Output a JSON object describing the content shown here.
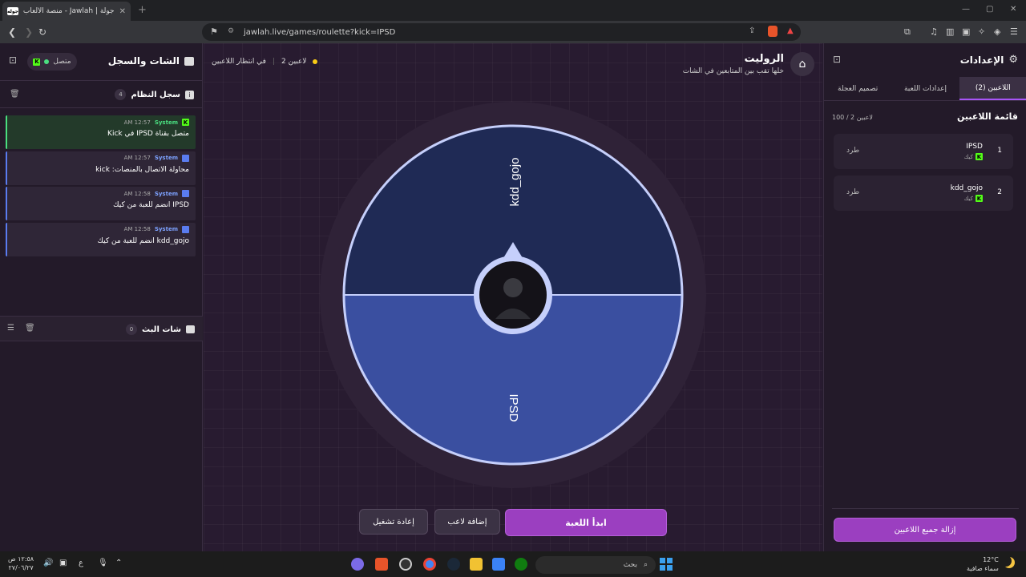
{
  "browser": {
    "tab_title": "جولة | Jawlah - منصة الألعاب التفا",
    "tab_badge": "جوله",
    "url": "jawlah.live/games/roulette?kick=IPSD"
  },
  "chat_panel": {
    "title": "الشات والسجل",
    "status": "متصل",
    "system_log": {
      "title": "سجل النظام",
      "count": "4",
      "entries": [
        {
          "who": "System",
          "time": "12:57 AM",
          "message": "متصل بقناة IPSD في Kick",
          "color": "#4ade80"
        },
        {
          "who": "System",
          "time": "12:57 AM",
          "message": "محاولة الاتصال بالمنصات: kick",
          "color": "#5a7cf0"
        },
        {
          "who": "System",
          "time": "12:58 AM",
          "message": "IPSD انضم للعبة من كيك",
          "color": "#5a7cf0"
        },
        {
          "who": "System",
          "time": "12:58 AM",
          "message": "kdd_gojo انضم للعبة من كيك",
          "color": "#5a7cf0"
        }
      ]
    },
    "stream_chat": {
      "title": "شات البث",
      "count": "0"
    }
  },
  "game_header": {
    "title": "الروليت",
    "subtitle": "خلها تقب بين المتابعين في الشات",
    "players_count": "2 لاعبين",
    "status": "في انتظار اللاعبين"
  },
  "wheel": {
    "segments": [
      {
        "label": "kdd_gojo",
        "color": "#1f2a55"
      },
      {
        "label": "IPSD",
        "color": "#3a4fa0"
      }
    ]
  },
  "actions": {
    "start": "ابدأ اللعبة",
    "add_player": "إضافة لاعب",
    "restart": "إعادة تشغيل"
  },
  "settings_panel": {
    "title": "الإعدادات",
    "tabs": [
      "اللاعبين (2)",
      "إعدادات اللعبة",
      "تصميم العجلة"
    ],
    "list_title": "قائمة اللاعبين",
    "list_count": "100 / 2 لاعبين",
    "players": [
      {
        "num": "1",
        "name": "IPSD",
        "source": "كيك",
        "action": "طرد"
      },
      {
        "num": "2",
        "name": "kdd_gojo",
        "source": "كيك",
        "action": "طرد"
      }
    ],
    "remove_all": "إزالة جميع اللاعبين"
  },
  "taskbar": {
    "search_placeholder": "بحث",
    "weather_temp": "12°C",
    "weather_desc": "سماء صافية",
    "time": "١٢:٥٨ ص",
    "date": "٢٧/٠٦/٢٧",
    "lang": "ع"
  }
}
